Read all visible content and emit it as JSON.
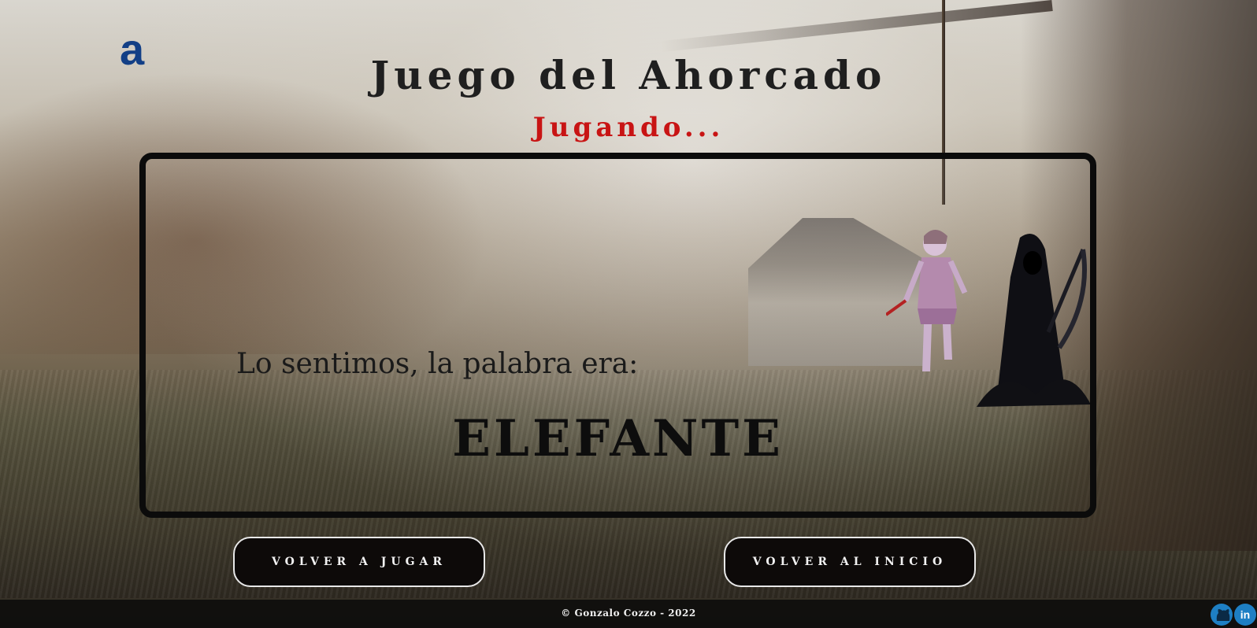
{
  "logo": {
    "text": "a"
  },
  "header": {
    "title": "Juego del Ahorcado",
    "status": "Jugando..."
  },
  "game": {
    "message": "Lo sentimos, la palabra era:",
    "word": "ELEFANTE"
  },
  "buttons": {
    "play_again": "VOLVER A JUGAR",
    "home": "VOLVER AL INICIO"
  },
  "footer": {
    "copyright": "© Gonzalo Cozzo - 2022",
    "social_icons": [
      "github-icon",
      "linkedin-icon"
    ]
  },
  "colors": {
    "title": "#1f1f1f",
    "status": "#c81414",
    "button_bg": "#0d0a09",
    "logo": "#123f86"
  }
}
